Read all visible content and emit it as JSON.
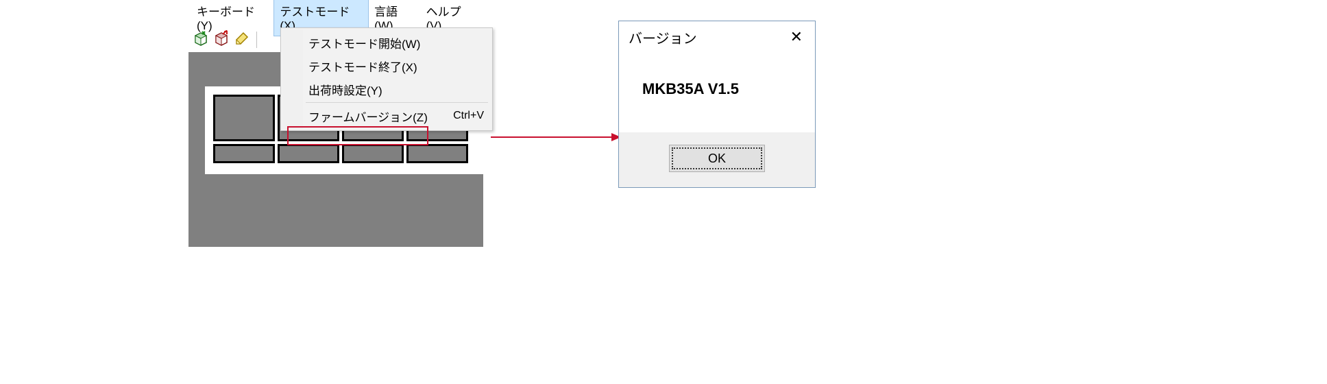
{
  "menubar": {
    "items": [
      {
        "label": "キーボード(Y)"
      },
      {
        "label": "テストモード(X)"
      },
      {
        "label": "言語(W)"
      },
      {
        "label": "ヘルプ(V)"
      }
    ],
    "active_index": 1
  },
  "dropdown": {
    "items": [
      {
        "label": "テストモード開始(W)",
        "shortcut": ""
      },
      {
        "label": "テストモード終了(X)",
        "shortcut": ""
      },
      {
        "label": "出荷時設定(Y)",
        "shortcut": ""
      },
      {
        "label": "ファームバージョン(Z)",
        "shortcut": "Ctrl+V"
      }
    ]
  },
  "dialog": {
    "title": "バージョン",
    "message": "MKB35A V1.5",
    "ok_label": "OK"
  },
  "icons": {
    "cube_green": "cube-green-icon",
    "cube_red": "cube-red-icon",
    "eraser": "eraser-icon"
  }
}
